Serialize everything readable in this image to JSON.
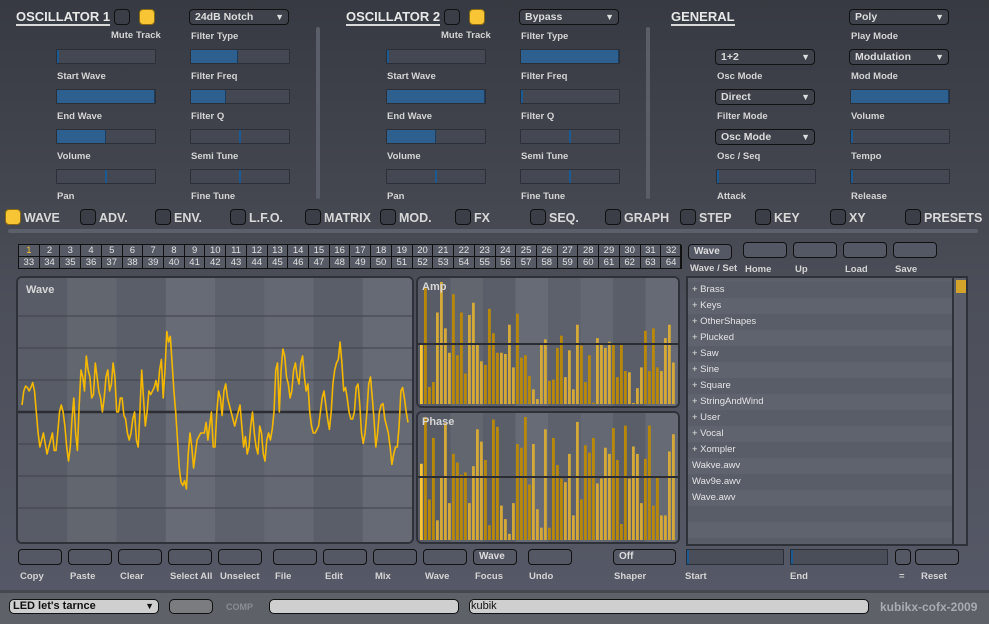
{
  "osc1": {
    "title": "OSCILLATOR 1",
    "mute_label": "Mute",
    "track_label": "Track",
    "mute_on": false,
    "track_on": true,
    "filter_type": {
      "label": "Filter Type",
      "value": "24dB Notch"
    },
    "start_wave": {
      "label": "Start Wave",
      "value": 0.0
    },
    "end_wave": {
      "label": "End Wave",
      "value": 1.0
    },
    "volume": {
      "label": "Volume",
      "value": 0.5
    },
    "pan": {
      "label": "Pan",
      "value": 0.5
    },
    "filter_freq": {
      "label": "Filter Freq",
      "value": 0.48
    },
    "filter_q": {
      "label": "Filter Q",
      "value": 0.36
    },
    "semi_tune": {
      "label": "Semi Tune",
      "value": 0.5
    },
    "fine_tune": {
      "label": "Fine Tune",
      "value": 0.5
    }
  },
  "osc2": {
    "title": "OSCILLATOR 2",
    "mute_label": "Mute",
    "track_label": "Track",
    "mute_on": false,
    "track_on": true,
    "filter_type": {
      "label": "Filter Type",
      "value": "Bypass"
    },
    "start_wave": {
      "label": "Start Wave",
      "value": 0.0
    },
    "end_wave": {
      "label": "End Wave",
      "value": 1.0
    },
    "volume": {
      "label": "Volume",
      "value": 0.5
    },
    "pan": {
      "label": "Pan",
      "value": 0.5
    },
    "filter_freq": {
      "label": "Filter Freq",
      "value": 1.0
    },
    "filter_q": {
      "label": "Filter Q",
      "value": 0.0
    },
    "semi_tune": {
      "label": "Semi Tune",
      "value": 0.5
    },
    "fine_tune": {
      "label": "Fine Tune",
      "value": 0.5
    }
  },
  "general": {
    "title": "GENERAL",
    "play_mode": {
      "label": "Play Mode",
      "value": "Poly"
    },
    "osc_mode": {
      "label": "Osc Mode",
      "value": "1+2"
    },
    "mod_mode": {
      "label": "Mod Mode",
      "value": "Modulation"
    },
    "filter_mode": {
      "label": "Filter Mode",
      "value": "Direct"
    },
    "volume": {
      "label": "Volume",
      "value": 1.0
    },
    "osc_seq": {
      "label": "Osc / Seq",
      "value": "Osc Mode"
    },
    "tempo": {
      "label": "Tempo",
      "value": 0.0
    },
    "attack": {
      "label": "Attack",
      "value": 0.0
    },
    "release": {
      "label": "Release",
      "value": 0.0
    }
  },
  "tabs": [
    {
      "label": "WAVE",
      "active": true
    },
    {
      "label": "ADV.",
      "active": false
    },
    {
      "label": "ENV.",
      "active": false
    },
    {
      "label": "L.F.O.",
      "active": false
    },
    {
      "label": "MATRIX",
      "active": false
    },
    {
      "label": "MOD.",
      "active": false
    },
    {
      "label": "FX",
      "active": false
    },
    {
      "label": "SEQ.",
      "active": false
    },
    {
      "label": "GRAPH",
      "active": false
    },
    {
      "label": "STEP",
      "active": false
    },
    {
      "label": "KEY",
      "active": false
    },
    {
      "label": "XY",
      "active": false
    },
    {
      "label": "PRESETS",
      "active": false
    }
  ],
  "wave_grid": {
    "selected": 1,
    "row1": [
      "1",
      "2",
      "3",
      "4",
      "5",
      "6",
      "7",
      "8",
      "9",
      "10",
      "11",
      "12",
      "13",
      "14",
      "15",
      "16",
      "17",
      "18",
      "19",
      "20",
      "21",
      "22",
      "23",
      "24",
      "25",
      "26",
      "27",
      "28",
      "29",
      "30",
      "31",
      "32"
    ],
    "row2": [
      "33",
      "34",
      "35",
      "36",
      "37",
      "38",
      "39",
      "40",
      "41",
      "42",
      "43",
      "44",
      "45",
      "46",
      "47",
      "48",
      "49",
      "50",
      "51",
      "52",
      "53",
      "54",
      "55",
      "56",
      "57",
      "58",
      "59",
      "60",
      "61",
      "62",
      "63",
      "64"
    ]
  },
  "browser": {
    "wave_set_value": "Wave",
    "wave_set_label": "Wave / Set",
    "home_label": "Home",
    "up_label": "Up",
    "load_label": "Load",
    "save_label": "Save",
    "items": [
      "+ Brass",
      "+ Keys",
      "+ OtherShapes",
      "+ Plucked",
      "+ Saw",
      "+ Sine",
      "+ Square",
      "+ StringAndWind",
      "+ User",
      "+ Vocal",
      "+ Xompler",
      "Wakve.awv",
      "Wav9e.awv",
      "Wave.awv"
    ]
  },
  "panels": {
    "wave_title": "Wave",
    "amp_title": "Amp",
    "phase_title": "Phase"
  },
  "wave_samples": [
    0.1,
    0.3,
    0.37,
    0.35,
    0.3,
    0.35,
    0.42,
    0.3,
    0.0,
    -0.3,
    -0.5,
    -0.4,
    -0.3,
    -0.45,
    -0.6,
    -0.5,
    -0.4,
    -0.3,
    -0.55,
    -0.55,
    -0.3,
    0.0,
    0.1,
    0.0,
    -0.2,
    -0.5,
    -0.7,
    -0.5,
    -0.1,
    0.2,
    -0.3,
    -0.55,
    0.1,
    0.6,
    0.5,
    0.3,
    0.8,
    0.6,
    0.5,
    0.2,
    0.25,
    0.7,
    0.5,
    0.3,
    0.2,
    0.0,
    0.2,
    0.5,
    0.6,
    0.3,
    0.4,
    0.7,
    0.5,
    0.0,
    0.0,
    0.2,
    0.2,
    -0.05,
    -0.1,
    -0.3,
    -0.4,
    -0.3,
    -0.1,
    0.0,
    -0.4,
    -0.5,
    0.0,
    0.6,
    0.2,
    -0.2,
    0.0,
    0.3,
    0.25,
    0.3,
    0.35,
    0.45,
    0.3,
    0.6,
    0.75,
    0.2,
    0.6,
    1.15,
    1.0,
    1.08,
    0.7,
    0.3,
    0.0,
    -0.4,
    -0.8,
    -1.0,
    -1.05,
    -0.98,
    -1.1,
    -0.6,
    -0.3,
    -0.5,
    -0.8,
    -0.6,
    -0.4,
    -0.35,
    -0.3,
    -0.3,
    -0.3,
    -0.15,
    -0.4,
    -0.2,
    0.0,
    -0.5,
    -0.5,
    0.0,
    0.3,
    0.2,
    -0.05,
    0.3,
    0.4,
    0.2,
    0.1,
    0.0,
    -0.1,
    -0.2,
    -0.1,
    0.0,
    0.1,
    -0.2,
    -0.5,
    -0.35,
    -0.6,
    -0.5,
    -0.2,
    0.0,
    -0.3,
    -0.5,
    -0.6,
    -0.2,
    -0.3,
    -0.6,
    -0.7,
    -0.4,
    -0.3,
    -0.4,
    -0.25,
    0.0,
    0.6,
    0.7,
    0.0,
    0.6,
    0.9,
    0.8,
    0.5,
    0.4,
    0.2,
    0.3,
    0.6,
    0.7,
    0.5,
    0.4,
    0.7,
    0.8,
    0.5,
    0.3,
    0.4,
    0.0,
    -0.2,
    -0.3,
    -0.3,
    -0.25,
    -0.2,
    0.0,
    0.2,
    0.3,
    0.1,
    -0.1,
    -0.25,
    0.0,
    0.4,
    0.6,
    0.7,
    0.75,
    1.0,
    0.7,
    0.3,
    0.35,
    0.2,
    0.0,
    -0.1,
    -0.1,
    0.0,
    0.35,
    0.4,
    0.1,
    -0.3,
    -0.45,
    -0.3,
    0.0,
    0.4,
    0.5,
    0.2,
    -0.1,
    -0.5,
    -0.3,
    0.0,
    0.1,
    0.12,
    -0.1,
    -0.2,
    -0.3,
    -0.5,
    -0.75,
    -0.6,
    -0.5,
    -0.5,
    -0.2,
    0.3,
    0.35,
    0.2,
    0.0,
    -0.15
  ],
  "amp_values": [
    0.5,
    0.95,
    0.14,
    0.18,
    0.75,
    1.0,
    0.62,
    0.42,
    0.9,
    0.4,
    0.75,
    0.25,
    0.73,
    0.83,
    0.5,
    0.35,
    0.32,
    0.78,
    0.58,
    0.42,
    0.42,
    0.41,
    0.65,
    0.3,
    0.74,
    0.38,
    0.4,
    0.23,
    0.12,
    0.04,
    0.5,
    0.53,
    0.19,
    0.2,
    0.46,
    0.56,
    0.22,
    0.44,
    0.12,
    0.65,
    0.48,
    0.18,
    0.4,
    0.01,
    0.54,
    0.5,
    0.46,
    0.51,
    0.5,
    0.22,
    0.5,
    0.27,
    0.26,
    0.0,
    0.13,
    0.3,
    0.6,
    0.27,
    0.62,
    0.3,
    0.27,
    0.54,
    0.65,
    0.34
  ],
  "phase_values": [
    0.62,
    1.0,
    0.33,
    0.83,
    0.16,
    0.52,
    0.95,
    0.3,
    0.7,
    0.63,
    0.53,
    0.55,
    0.3,
    0.6,
    0.9,
    0.8,
    0.65,
    0.12,
    0.98,
    0.92,
    0.28,
    0.17,
    0.05,
    0.3,
    0.78,
    0.75,
    1.0,
    0.45,
    0.78,
    0.25,
    0.1,
    0.9,
    0.1,
    0.83,
    0.61,
    0.5,
    0.47,
    0.7,
    0.2,
    0.96,
    0.33,
    0.77,
    0.71,
    0.83,
    0.46,
    0.5,
    0.75,
    0.7,
    0.91,
    0.65,
    0.13,
    0.93,
    0.5,
    0.76,
    0.7,
    0.3,
    0.66,
    0.93,
    0.28,
    0.52,
    0.2,
    0.2,
    0.72,
    0.86
  ],
  "actions": {
    "copy": "Copy",
    "paste": "Paste",
    "clear": "Clear",
    "select_all": "Select All",
    "unselect": "Unselect",
    "file": "File",
    "edit": "Edit",
    "mix": "Mix",
    "wave": "Wave",
    "focus_value": "Wave",
    "focus": "Focus",
    "undo": "Undo",
    "shaper_value": "Off",
    "shaper": "Shaper",
    "start": "Start",
    "end": "End",
    "equals": "=",
    "reset": "Reset"
  },
  "status_bar": {
    "preset": "LED let's tarnce",
    "comp_label": "COMP",
    "comp_field": "",
    "author": "kubik",
    "brand": "kubikx-cofx-2009"
  },
  "colors": {
    "accent": "#f8c535",
    "slider_fill": "#2d5f8f",
    "wave_line": "#f5b800",
    "bar_dark": "#b8880a",
    "bar_light": "#d4a937"
  }
}
